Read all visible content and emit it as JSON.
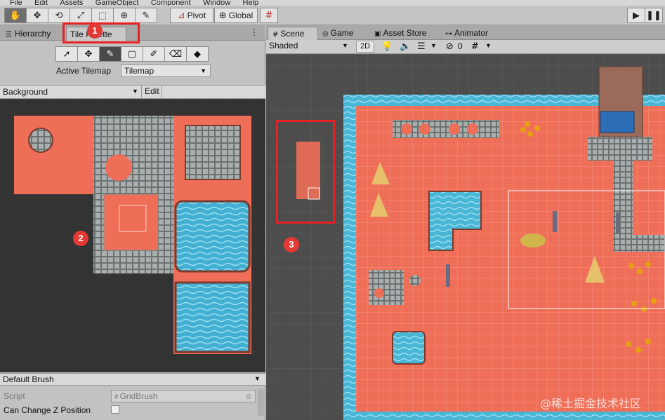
{
  "menu": {
    "items": [
      "File",
      "Edit",
      "Assets",
      "GameObject",
      "Component",
      "Window",
      "Help"
    ]
  },
  "toolbar": {
    "pivot_label": "Pivot",
    "global_label": "Global",
    "tools": [
      "hand-tool",
      "move-tool",
      "rotate-tool",
      "scale-tool",
      "rect-tool",
      "transform-tool",
      "custom-tool"
    ]
  },
  "left": {
    "tabs": {
      "hierarchy": "Hierarchy",
      "tile_palette": "Tile Palette"
    },
    "active_tilemap_label": "Active Tilemap",
    "active_tilemap_value": "Tilemap",
    "palette_name": "Background",
    "edit_label": "Edit",
    "brush_name": "Default Brush",
    "script_label": "Script",
    "script_value": "GridBrush",
    "can_change_z_label": "Can Change Z Position"
  },
  "scene": {
    "tabs": {
      "scene": "Scene",
      "game": "Game",
      "asset_store": "Asset Store",
      "animator": "Animator"
    },
    "shading_mode": "Shaded",
    "mode_2d": "2D",
    "hidden_count": "0"
  },
  "annotations": {
    "one": "1",
    "two": "2",
    "three": "3"
  },
  "watermark": "@稀土掘金技术社区",
  "colors": {
    "annotation_red": "#e53935",
    "terrain": "#ef6e58",
    "water": "#4ab6d6",
    "stone": "#a5abaa"
  }
}
